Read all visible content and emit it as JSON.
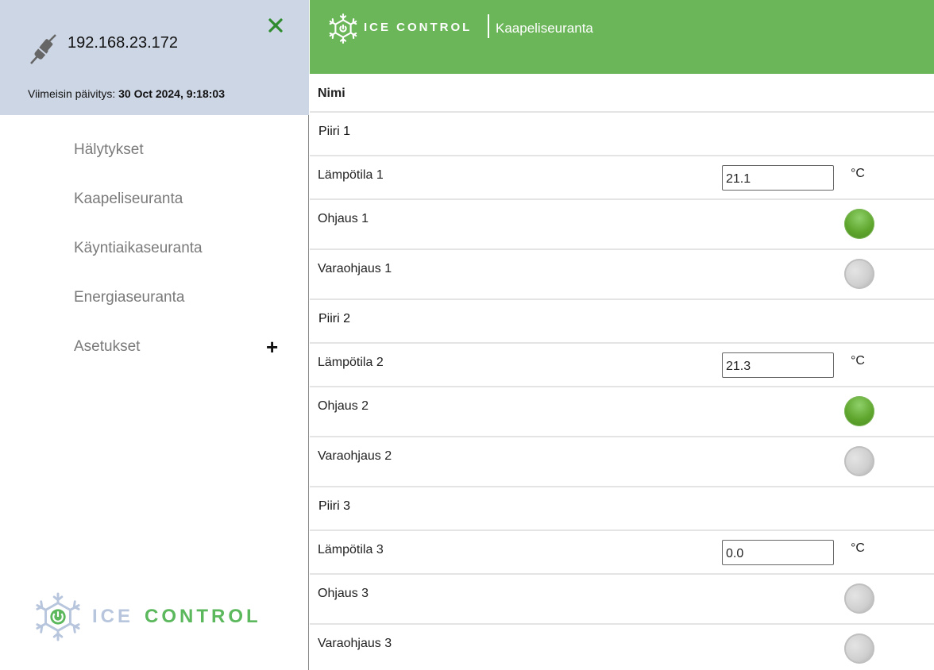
{
  "sidebar": {
    "ip": "192.168.23.172",
    "last_update_label": "Viimeisin päivitys:",
    "last_update_value": "30 Oct 2024, 9:18:03",
    "close_icon": "close-x-icon",
    "connection_icon": "plug-icon",
    "nav": [
      {
        "label": "Hälytykset"
      },
      {
        "label": "Kaapeliseuranta"
      },
      {
        "label": "Käyntiaikaseuranta"
      },
      {
        "label": "Energiaseuranta"
      },
      {
        "label": "Asetukset",
        "expand": "+"
      }
    ],
    "logo": {
      "ice": "ICE",
      "control": "CONTROL"
    }
  },
  "topbar": {
    "brand": "ICE CONTROL",
    "page_title": "Kaapeliseuranta"
  },
  "table": {
    "header": "Nimi",
    "circuits": [
      {
        "name": "Piiri  1",
        "temp_label": "Lämpötila 1",
        "temp_value": "21.1",
        "unit": "°C",
        "control_label": "Ohjaus 1",
        "control_on": true,
        "backup_label": "Varaohjaus 1",
        "backup_on": false
      },
      {
        "name": "Piiri  2",
        "temp_label": "Lämpötila 2",
        "temp_value": "21.3",
        "unit": "°C",
        "control_label": "Ohjaus 2",
        "control_on": true,
        "backup_label": "Varaohjaus 2",
        "backup_on": false
      },
      {
        "name": "Piiri  3",
        "temp_label": "Lämpötila 3",
        "temp_value": "0.0",
        "unit": "°C",
        "control_label": "Ohjaus 3",
        "control_on": false,
        "backup_label": "Varaohjaus 3",
        "backup_on": false
      }
    ]
  },
  "colors": {
    "accent_green": "#6cb65a",
    "sidebar_header": "#cdd6e4",
    "led_on": "#5fa62e",
    "led_off": "#cfcfcf",
    "close_icon": "#2e8b2e"
  }
}
